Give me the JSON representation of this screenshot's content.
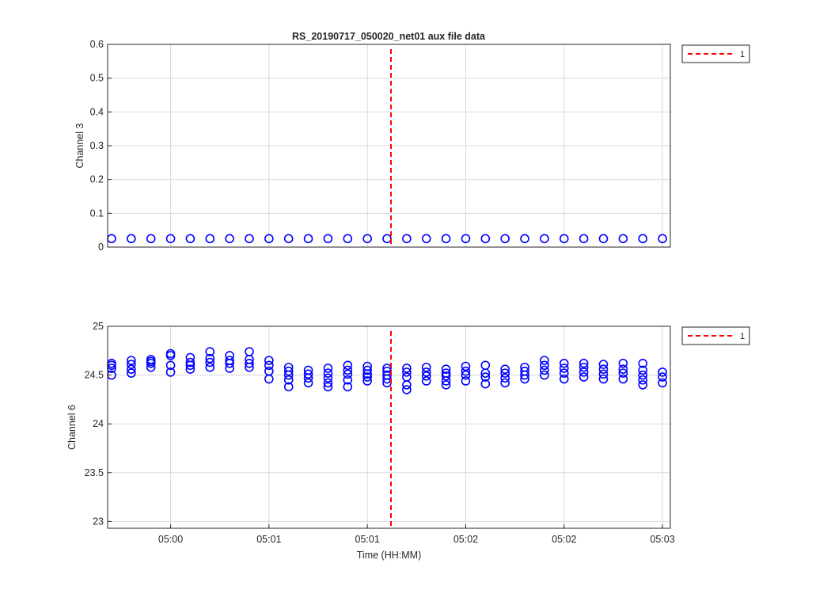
{
  "figure": {
    "title": "RS_20190717_050020_net01 aux file data",
    "colors": {
      "marker": "#0000ff",
      "event_line": "#ff0000",
      "grid": "#d9d9d9",
      "axes": "#262626"
    }
  },
  "chart_data": [
    {
      "type": "scatter",
      "title": "RS_20190717_050020_net01 aux file data",
      "xlabel": "",
      "ylabel": "Channel 3",
      "ylim": [
        0,
        0.6
      ],
      "yticks": [
        "0",
        "0.1",
        "0.2",
        "0.3",
        "0.4",
        "0.5",
        "0.6"
      ],
      "xticks": [],
      "grid": true,
      "legend": {
        "placement": "outside-top-right",
        "entries": [
          {
            "label": "1",
            "style": "red-dashed"
          }
        ]
      },
      "event_line_x": 14.2,
      "series": [
        {
          "x": [
            0,
            1,
            2,
            3,
            4,
            5,
            6,
            7,
            8,
            9,
            10,
            11,
            12,
            13,
            14,
            15,
            16,
            17,
            18,
            19,
            20,
            21,
            22,
            23,
            24,
            25,
            26,
            27,
            28
          ],
          "y": [
            0.025,
            0.025,
            0.025,
            0.025,
            0.025,
            0.025,
            0.025,
            0.025,
            0.025,
            0.025,
            0.025,
            0.025,
            0.025,
            0.025,
            0.025,
            0.025,
            0.025,
            0.025,
            0.025,
            0.025,
            0.025,
            0.025,
            0.025,
            0.025,
            0.025,
            0.025,
            0.025,
            0.025,
            0.025
          ]
        }
      ]
    },
    {
      "type": "scatter",
      "title": "",
      "xlabel": "Time (HH:MM)",
      "ylabel": "Channel 6",
      "ylim": [
        23.9,
        25
      ],
      "yticks": [
        "23",
        "23.5",
        "24",
        "24.5",
        "25"
      ],
      "xticks": [
        "05:00",
        "05:01",
        "05:01",
        "05:02",
        "05:02",
        "05:03"
      ],
      "grid": true,
      "legend": {
        "placement": "outside-top-right",
        "entries": [
          {
            "label": "1",
            "style": "red-dashed"
          }
        ]
      },
      "event_line_x": 14.2,
      "series": [
        {
          "x": [
            0,
            1,
            2,
            3,
            4,
            5,
            6,
            7,
            8,
            9,
            10,
            11,
            12,
            13,
            14,
            15,
            16,
            17,
            18,
            19,
            20,
            21,
            22,
            23,
            24,
            25,
            26,
            27,
            28
          ],
          "y": [
            [
              24.5,
              24.57,
              24.6,
              24.62
            ],
            [
              24.52,
              24.56,
              24.61,
              24.65
            ],
            [
              24.58,
              24.62,
              24.64,
              24.66
            ],
            [
              24.53,
              24.6,
              24.7,
              24.72
            ],
            [
              24.56,
              24.6,
              24.63,
              24.68
            ],
            [
              24.58,
              24.63,
              24.67,
              24.74
            ],
            [
              24.57,
              24.62,
              24.65,
              24.7
            ],
            [
              24.58,
              24.62,
              24.66,
              24.74
            ],
            [
              24.46,
              24.54,
              24.6,
              24.65
            ],
            [
              24.38,
              24.45,
              24.5,
              24.54,
              24.58
            ],
            [
              24.42,
              24.47,
              24.51,
              24.55
            ],
            [
              24.38,
              24.42,
              24.47,
              24.52,
              24.57
            ],
            [
              24.38,
              24.45,
              24.51,
              24.55,
              24.6
            ],
            [
              24.44,
              24.48,
              24.51,
              24.55,
              24.59
            ],
            [
              24.42,
              24.46,
              24.5,
              24.54,
              24.57
            ],
            [
              24.35,
              24.4,
              24.48,
              24.53,
              24.57
            ],
            [
              24.44,
              24.49,
              24.53,
              24.58
            ],
            [
              24.4,
              24.44,
              24.49,
              24.52,
              24.56
            ],
            [
              24.44,
              24.5,
              24.54,
              24.59
            ],
            [
              24.41,
              24.48,
              24.52,
              24.6
            ],
            [
              24.42,
              24.47,
              24.52,
              24.56
            ],
            [
              24.46,
              24.5,
              24.54,
              24.58
            ],
            [
              24.5,
              24.55,
              24.6,
              24.65
            ],
            [
              24.46,
              24.52,
              24.57,
              24.62
            ],
            [
              24.48,
              24.53,
              24.58,
              24.62
            ],
            [
              24.46,
              24.51,
              24.56,
              24.61
            ],
            [
              24.46,
              24.52,
              24.56,
              24.62
            ],
            [
              24.4,
              24.45,
              24.5,
              24.55,
              24.62
            ],
            [
              24.42,
              24.48,
              24.53
            ]
          ]
        }
      ]
    }
  ]
}
